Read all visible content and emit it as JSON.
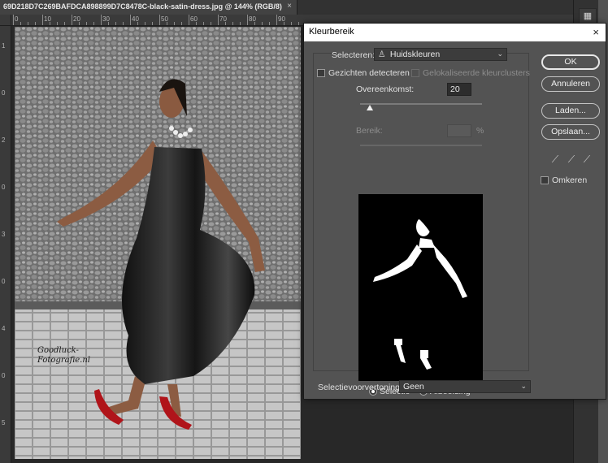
{
  "document": {
    "tab_title": "69D218D7C269BAFDCA898899D7C8478C-black-satin-dress.jpg @ 144% (RGB/8)",
    "close_label": "×"
  },
  "ruler": {
    "h_labels": [
      "0",
      "10",
      "20",
      "30",
      "40",
      "50",
      "60",
      "70",
      "80",
      "90"
    ],
    "v_labels": [
      "1",
      "0",
      "2",
      "0",
      "3",
      "0",
      "4",
      "0",
      "5"
    ]
  },
  "photo": {
    "watermark_line1": "Goodluck-",
    "watermark_line2": "Fotografie.nl"
  },
  "dialog": {
    "title": "Kleurbereik",
    "close_label": "×",
    "select_label": "Selecteren:",
    "select_value": "Huidskleuren",
    "detect_faces_label": "Gezichten detecteren",
    "localized_clusters_label": "Gelokaliseerde kleurclusters",
    "fuzziness_label": "Overeenkomst:",
    "fuzziness_value": "20",
    "fuzziness_fraction": 0.08,
    "range_label": "Bereik:",
    "range_unit": "%",
    "selection_radio": "Selectie",
    "image_radio": "Afbeelding",
    "preview_mode_label": "Selectievoorvertoning:",
    "preview_mode_value": "Geen",
    "ok_label": "OK",
    "cancel_label": "Annuleren",
    "load_label": "Laden...",
    "save_label": "Opslaan...",
    "invert_label": "Omkeren",
    "eyedroppers": [
      "eyedropper-icon",
      "eyedropper-plus-icon",
      "eyedropper-minus-icon"
    ]
  },
  "right_panel": {
    "tool_icon": "layers-icon"
  }
}
